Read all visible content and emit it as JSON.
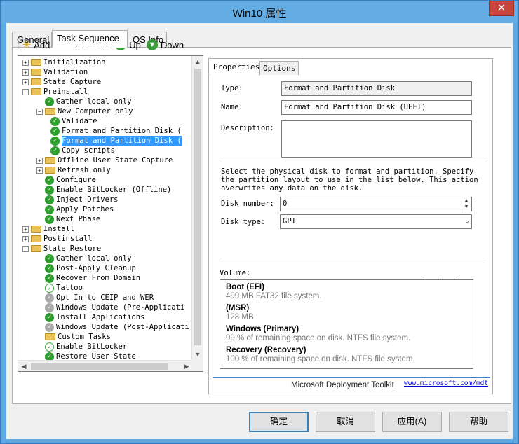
{
  "window": {
    "title": "Win10 属性",
    "close": "✕"
  },
  "main_tabs": [
    {
      "label": "General"
    },
    {
      "label": "Task Sequence"
    },
    {
      "label": "OS Info"
    }
  ],
  "toolbar": {
    "add": "Add",
    "remove": "Remove",
    "up": "Up",
    "down": "Down"
  },
  "tree": {
    "items": [
      {
        "label": "Initialization",
        "level": 0,
        "icon": "folder",
        "expander": "+"
      },
      {
        "label": "Validation",
        "level": 0,
        "icon": "folder",
        "expander": "+"
      },
      {
        "label": "State Capture",
        "level": 0,
        "icon": "folder",
        "expander": "+"
      },
      {
        "label": "Preinstall",
        "level": 0,
        "icon": "folder",
        "expander": "−"
      },
      {
        "label": "Gather local only",
        "level": 1,
        "icon": "check"
      },
      {
        "label": "New Computer only",
        "level": 1,
        "icon": "folder",
        "expander": "−"
      },
      {
        "label": "Validate",
        "level": 2,
        "icon": "check"
      },
      {
        "label": "Format and Partition Disk (",
        "level": 2,
        "icon": "check"
      },
      {
        "label": "Format and Partition Disk (",
        "level": 2,
        "icon": "check",
        "selected": true
      },
      {
        "label": "Copy scripts",
        "level": 2,
        "icon": "check"
      },
      {
        "label": "Offline User State Capture",
        "level": 1,
        "icon": "folder",
        "expander": "+"
      },
      {
        "label": "Refresh only",
        "level": 1,
        "icon": "folder",
        "expander": "+"
      },
      {
        "label": "Configure",
        "level": 1,
        "icon": "check"
      },
      {
        "label": "Enable BitLocker (Offline)",
        "level": 1,
        "icon": "check"
      },
      {
        "label": "Inject Drivers",
        "level": 1,
        "icon": "check"
      },
      {
        "label": "Apply Patches",
        "level": 1,
        "icon": "check"
      },
      {
        "label": "Next Phase",
        "level": 1,
        "icon": "check"
      },
      {
        "label": "Install",
        "level": 0,
        "icon": "folder",
        "expander": "+"
      },
      {
        "label": "Postinstall",
        "level": 0,
        "icon": "folder",
        "expander": "+"
      },
      {
        "label": "State Restore",
        "level": 0,
        "icon": "folder",
        "expander": "−"
      },
      {
        "label": "Gather local only",
        "level": 1,
        "icon": "check"
      },
      {
        "label": "Post-Apply Cleanup",
        "level": 1,
        "icon": "check"
      },
      {
        "label": "Recover From Domain",
        "level": 1,
        "icon": "check"
      },
      {
        "label": "Tattoo",
        "level": 1,
        "icon": "check-light"
      },
      {
        "label": "Opt In to CEIP and WER",
        "level": 1,
        "icon": "check-gray"
      },
      {
        "label": "Windows Update (Pre-Applicati",
        "level": 1,
        "icon": "check-gray"
      },
      {
        "label": "Install Applications",
        "level": 1,
        "icon": "check"
      },
      {
        "label": "Windows Update (Post-Applicati",
        "level": 1,
        "icon": "check-gray"
      },
      {
        "label": "Custom Tasks",
        "level": 1,
        "icon": "folder"
      },
      {
        "label": "Enable BitLocker",
        "level": 1,
        "icon": "check-light"
      },
      {
        "label": "Restore User State",
        "level": 1,
        "icon": "check"
      }
    ]
  },
  "prop_tabs": [
    {
      "label": "Properties"
    },
    {
      "label": "Options"
    }
  ],
  "properties": {
    "type_label": "Type:",
    "type_value": "Format and Partition Disk",
    "name_label": "Name:",
    "name_value": "Format and Partition Disk (UEFI)",
    "description_label": "Description:",
    "description_value": "",
    "instructions": [
      "Select the physical disk to format and partition.  Specify",
      "the partition layout to use in the list below. This action",
      "overwrites any data on the disk."
    ],
    "disk_number_label": "Disk number:",
    "disk_number_value": "0",
    "disk_type_label": "Disk type:",
    "disk_type_value": "GPT",
    "volume_label": "Volume:"
  },
  "volumes": [
    {
      "title": "Boot (EFI)",
      "detail": "499 MB FAT32 file system."
    },
    {
      "title": " (MSR)",
      "detail": " 128 MB"
    },
    {
      "title": "Windows (Primary)",
      "detail": "99 % of remaining space on disk. NTFS file system."
    },
    {
      "title": "Recovery (Recovery)",
      "detail": "100 % of remaining space on disk. NTFS file system."
    }
  ],
  "footer": {
    "brand": "Microsoft Deployment Toolkit",
    "link": "www.microsoft.com/mdt"
  },
  "buttons": {
    "ok": "确定",
    "cancel": "取消",
    "apply": "应用(A)",
    "help": "帮助"
  },
  "colors": {
    "title_bar": "#64ace4",
    "selection": "#3399ff",
    "check_green": "#2e9e2e",
    "close_red": "#c7453b"
  }
}
